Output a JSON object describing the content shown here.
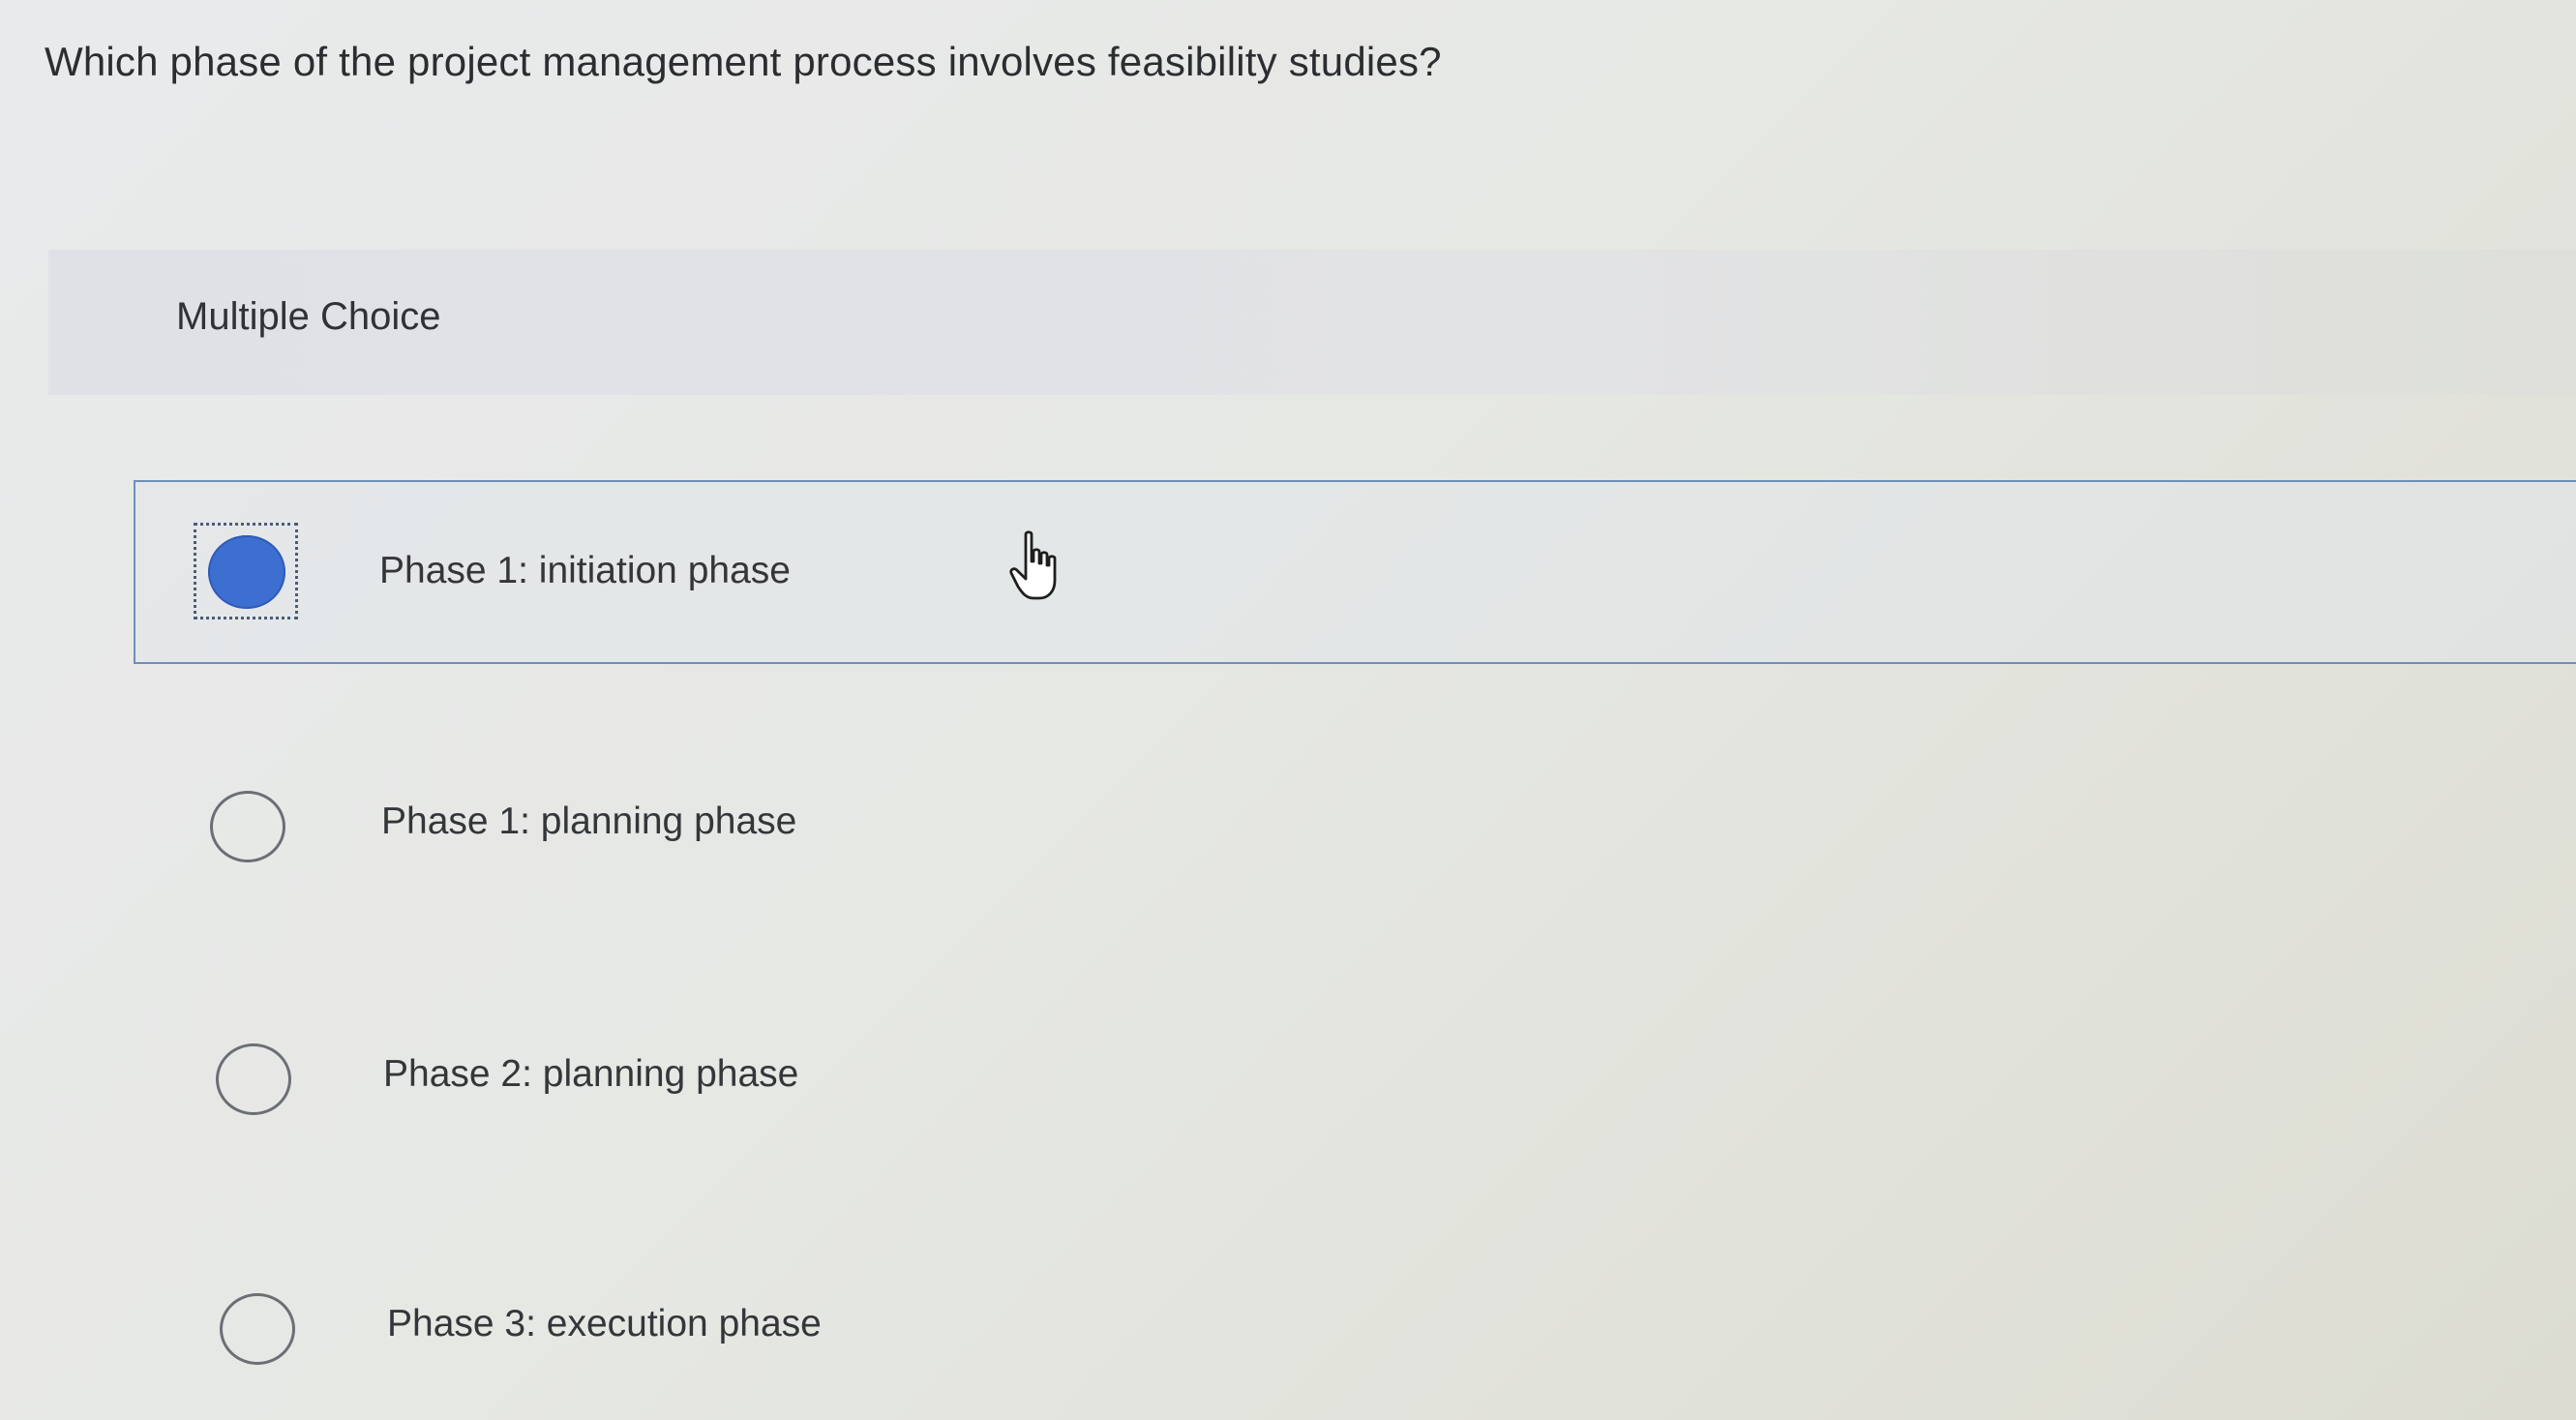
{
  "question": {
    "text": "Which phase of the project management process involves feasibility studies?"
  },
  "section": {
    "label": "Multiple Choice"
  },
  "options": [
    {
      "label": "Phase 1: initiation phase",
      "selected": true
    },
    {
      "label": "Phase 1: planning phase",
      "selected": false
    },
    {
      "label": "Phase 2: planning phase",
      "selected": false
    },
    {
      "label": "Phase 3: execution phase",
      "selected": false
    }
  ],
  "colors": {
    "selected_radio": "#3d6fd1",
    "selected_border": "#6d8fb8",
    "panel_bg": "#e0e2e6"
  },
  "icons": {
    "cursor": "hand-pointer-icon"
  }
}
